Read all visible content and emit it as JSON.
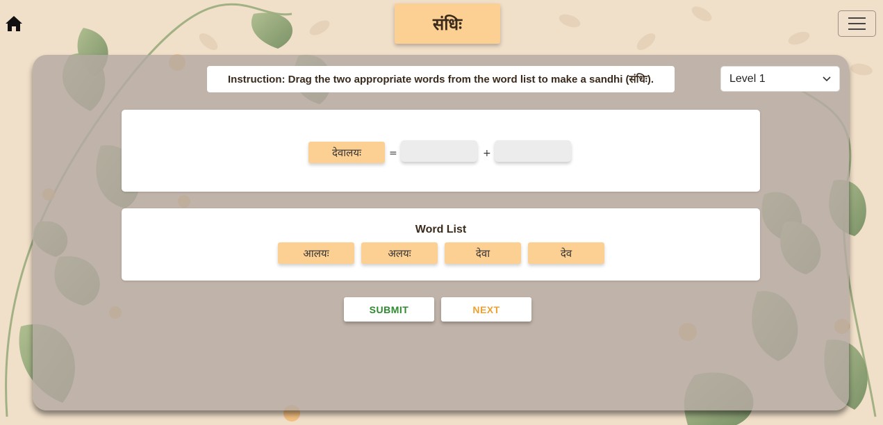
{
  "header": {
    "title": "संधिः"
  },
  "instruction": {
    "text": "Instruction: Drag the two appropriate words from the word list to make a sandhi (संधिः)."
  },
  "level": {
    "selected": "Level 1"
  },
  "equation": {
    "result": "देवालयः",
    "equals": "=",
    "plus": "+"
  },
  "word_list": {
    "title": "Word List",
    "words": [
      "आलयः",
      "अलयः",
      "देवा",
      "देव"
    ]
  },
  "buttons": {
    "submit": "SUBMIT",
    "next": "NEXT"
  },
  "background": {
    "watermark_words": [
      "देववाणी संस्कृत",
      "गायन्ति",
      "मयूरः",
      "एते"
    ]
  },
  "colors": {
    "chip": "#fccf92",
    "submit": "#2e8a2e",
    "next": "#f0a030",
    "page_bg": "#f0dfc9"
  }
}
